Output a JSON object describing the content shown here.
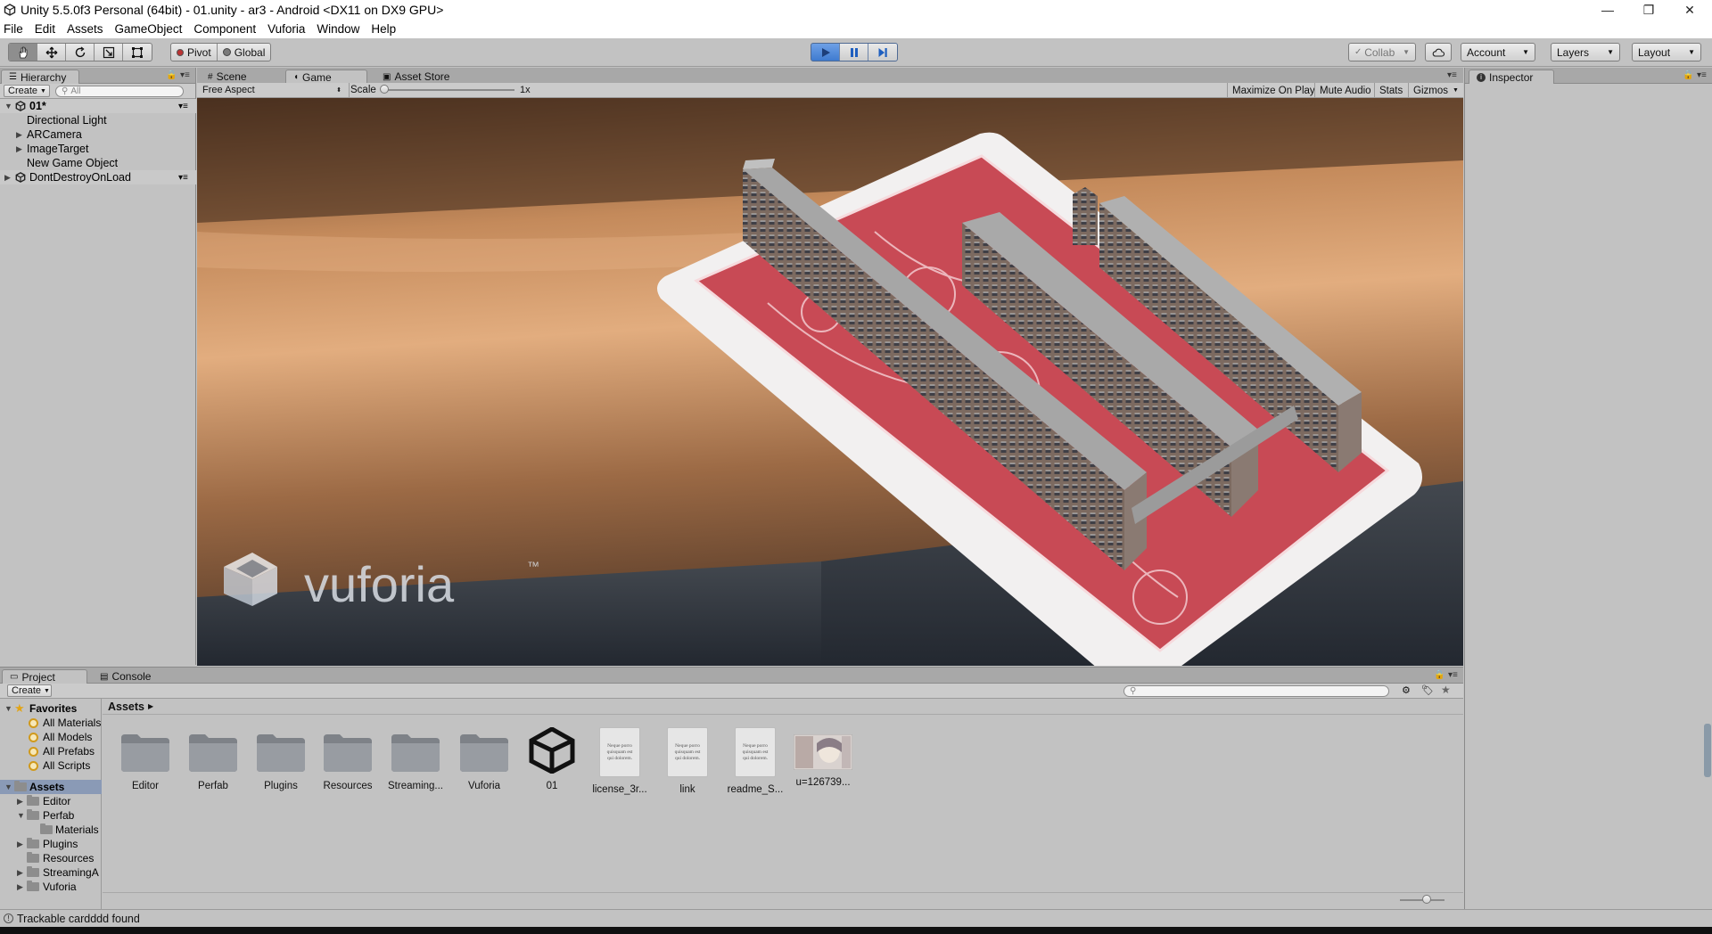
{
  "window": {
    "title": "Unity 5.5.0f3 Personal (64bit) - 01.unity - ar3 - Android <DX11 on DX9 GPU>",
    "controls": {
      "minimize": "—",
      "maximize": "❐",
      "close": "✕"
    }
  },
  "menu": [
    "File",
    "Edit",
    "Assets",
    "GameObject",
    "Component",
    "Vuforia",
    "Window",
    "Help"
  ],
  "toolbar": {
    "pivot_label": "Pivot",
    "global_label": "Global",
    "collab_label": "Collab",
    "account_label": "Account",
    "layers_label": "Layers",
    "layout_label": "Layout",
    "play_mode_active": true
  },
  "hierarchy": {
    "tab_label": "Hierarchy",
    "create_label": "Create",
    "search_placeholder": "All",
    "scene_name": "01*",
    "items": [
      "Directional Light",
      "ARCamera",
      "ImageTarget",
      "New Game Object"
    ],
    "dontdestroy": "DontDestroyOnLoad"
  },
  "center_tabs": {
    "scene": "Scene",
    "game": "Game",
    "asset_store": "Asset Store"
  },
  "game_toolbar": {
    "aspect": "Free Aspect",
    "scale_label": "Scale",
    "scale_value": "1x",
    "maximize_on_play": "Maximize On Play",
    "mute_audio": "Mute Audio",
    "stats": "Stats",
    "gizmos": "Gizmos"
  },
  "game_view": {
    "watermark": "vuforia",
    "watermark_tm": "™"
  },
  "inspector": {
    "tab_label": "Inspector"
  },
  "project": {
    "tab_project": "Project",
    "tab_console": "Console",
    "create_label": "Create",
    "breadcrumb": "Assets",
    "favorites_label": "Favorites",
    "favorites": [
      "All Materials",
      "All Models",
      "All Prefabs",
      "All Scripts"
    ],
    "assets_label": "Assets",
    "tree": [
      {
        "label": "Editor",
        "indent": 1,
        "expand": "closed"
      },
      {
        "label": "Perfab",
        "indent": 1,
        "expand": "open"
      },
      {
        "label": "Materials",
        "indent": 2,
        "expand": "none"
      },
      {
        "label": "Plugins",
        "indent": 1,
        "expand": "closed"
      },
      {
        "label": "Resources",
        "indent": 1,
        "expand": "none"
      },
      {
        "label": "StreamingA",
        "indent": 1,
        "expand": "closed"
      },
      {
        "label": "Vuforia",
        "indent": 1,
        "expand": "closed"
      }
    ],
    "assets": [
      {
        "label": "Editor",
        "kind": "folder"
      },
      {
        "label": "Perfab",
        "kind": "folder"
      },
      {
        "label": "Plugins",
        "kind": "folder"
      },
      {
        "label": "Resources",
        "kind": "folder"
      },
      {
        "label": "Streaming...",
        "kind": "folder"
      },
      {
        "label": "Vuforia",
        "kind": "folder"
      },
      {
        "label": "01",
        "kind": "scene"
      },
      {
        "label": "license_3r...",
        "kind": "text"
      },
      {
        "label": "link",
        "kind": "text"
      },
      {
        "label": "readme_S...",
        "kind": "text"
      },
      {
        "label": "u=126739...",
        "kind": "image"
      }
    ],
    "doc_preview_lines": [
      "Neque porro",
      "quisquam est",
      "qui dolorem."
    ]
  },
  "status": {
    "message": "Trackable cardddd found"
  },
  "colors": {
    "play_blue": "#4a8ae0",
    "toolbar_bg": "#c2c2c2",
    "card_red": "#c84a55"
  }
}
